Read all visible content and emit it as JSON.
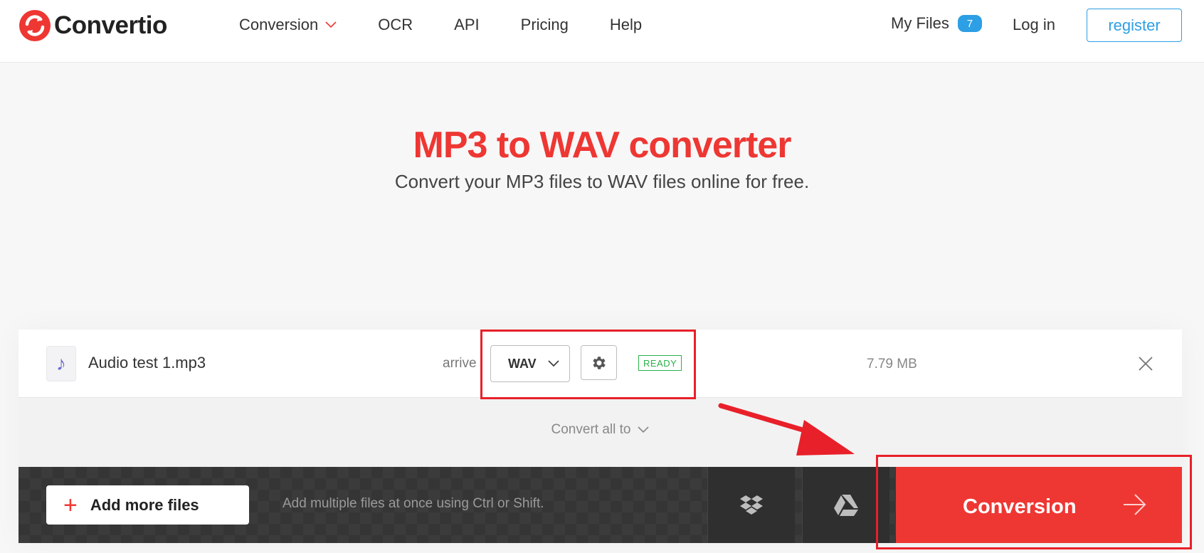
{
  "brand": {
    "name": "Convertio"
  },
  "nav": {
    "items": [
      {
        "label": "Conversion",
        "has_dropdown": true
      },
      {
        "label": "OCR"
      },
      {
        "label": "API"
      },
      {
        "label": "Pricing"
      },
      {
        "label": "Help"
      }
    ]
  },
  "account": {
    "my_files_label": "My Files",
    "my_files_count": "7",
    "login_label": "Log in",
    "register_label": "register"
  },
  "hero": {
    "title": "MP3 to WAV converter",
    "subtitle": "Convert your MP3 files to WAV files online for free."
  },
  "file": {
    "name": "Audio test 1.mp3",
    "arrive_label": "arrive",
    "target_format": "WAV",
    "status": "READY",
    "size": "7.79 MB",
    "icon": "music-note-icon"
  },
  "convert_all_label": "Convert all to",
  "bottom_bar": {
    "add_files_label": "Add more files",
    "hint": "Add multiple files at once using Ctrl or Shift.",
    "convert_label": "Conversion"
  },
  "colors": {
    "accent_red": "#ee3733",
    "link_blue": "#2d9fe4",
    "ready_green": "#2bb04a",
    "annotation_red": "#e8202a"
  }
}
